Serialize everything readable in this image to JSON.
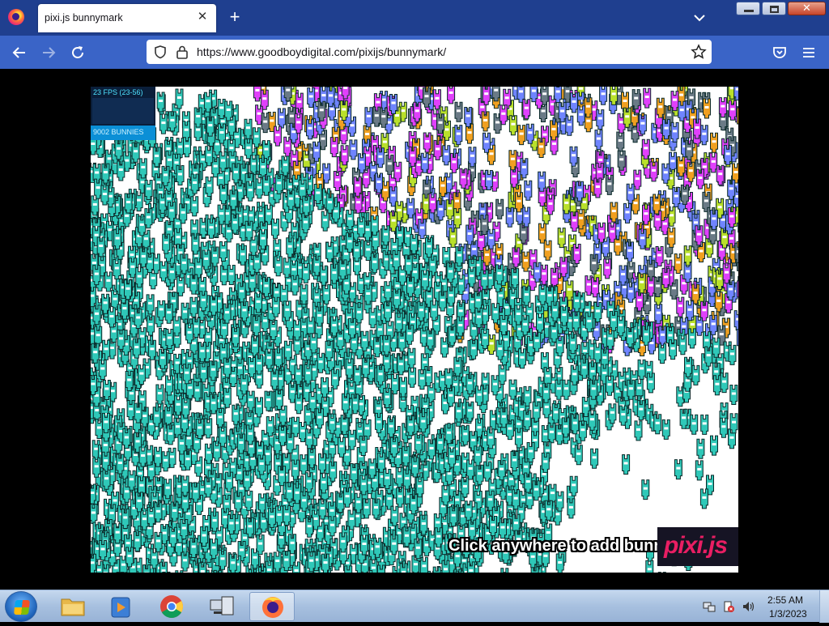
{
  "browser": {
    "tab": {
      "title": "pixi.js bunnymark"
    },
    "url": "https://www.goodboydigital.com/pixijs/bunnymark/"
  },
  "page": {
    "fps_label": "23 FPS (23-56)",
    "bunny_count_label": "9002 BUNNIES",
    "cta": "Click anywhere to add bunnies!",
    "logo": "pixi.js"
  },
  "taskbar": {
    "items": [
      {
        "name": "windows-explorer",
        "icon": "folder-icon"
      },
      {
        "name": "windows-media-player",
        "icon": "media-player-icon"
      },
      {
        "name": "google-chrome",
        "icon": "chrome-icon"
      },
      {
        "name": "network",
        "icon": "network-computer-icon"
      },
      {
        "name": "firefox",
        "icon": "firefox-icon",
        "active": true
      }
    ],
    "clock": {
      "time": "2:55 AM",
      "date": "1/3/2023"
    }
  },
  "colors": {
    "tabbar": "#1f3f8f",
    "navbar": "#3a64c7",
    "bunny_teal": "#2fc8b8",
    "bunny_magenta": "#e040fb",
    "bunny_blue": "#6f84ff",
    "bunny_lime": "#b9e02b",
    "bunny_orange": "#f0a020",
    "bunny_gray": "#6a7a86",
    "pixi_pink": "#e91e63"
  }
}
